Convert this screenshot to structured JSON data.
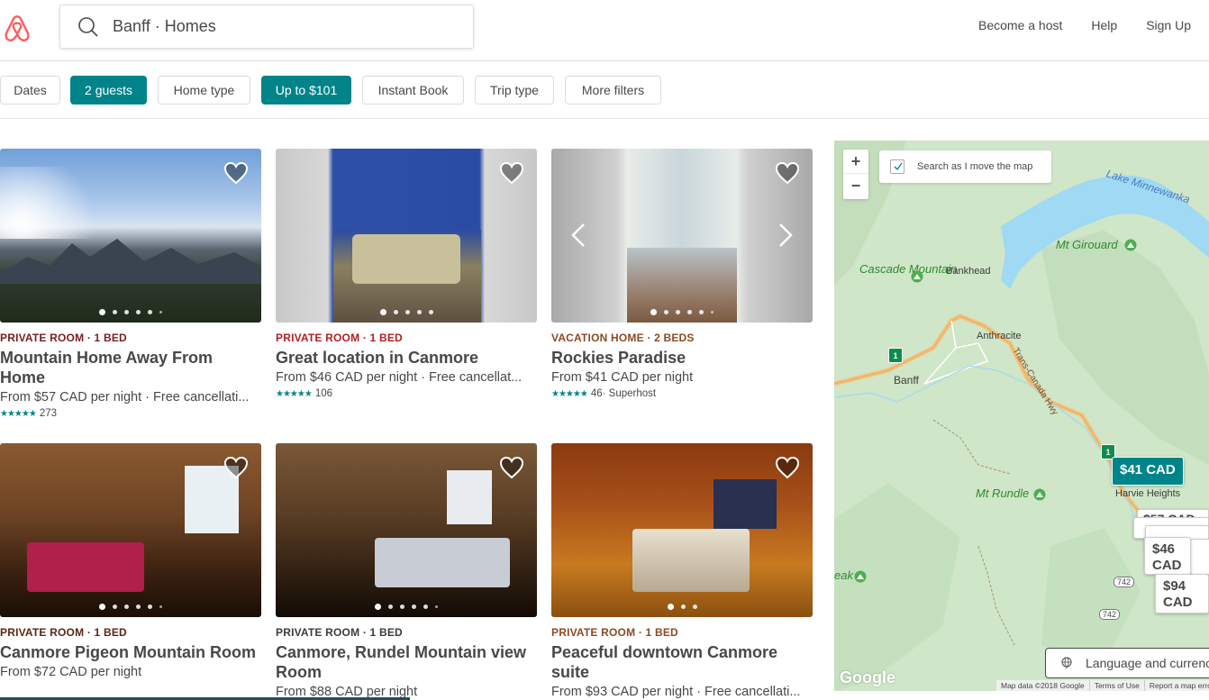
{
  "header": {
    "logo": "airbnb-logo",
    "search_value": "Banff · Homes",
    "nav": [
      "Become a host",
      "Help",
      "Sign Up"
    ]
  },
  "filters": [
    {
      "label": "Dates",
      "active": false
    },
    {
      "label": "2 guests",
      "active": true
    },
    {
      "label": "Home type",
      "active": false
    },
    {
      "label": "Up to $101",
      "active": true
    },
    {
      "label": "Instant Book",
      "active": false
    },
    {
      "label": "Trip type",
      "active": false
    },
    {
      "label": "More filters",
      "active": false
    }
  ],
  "colors": {
    "accent": "#008489",
    "brand": "#FF5A5F",
    "type_private_room_1": "#7B1D1D",
    "type_private_room_2": "#B21F1F",
    "type_vacation_home": "#8B4A22",
    "type_private_room_4": "#5C2614",
    "type_private_room_5": "#3B3B3B",
    "type_private_room_6": "#8B4A22"
  },
  "listings": [
    {
      "type": "PRIVATE ROOM · 1 BED",
      "title": "Mountain Home Away From Home",
      "price": "From $57 CAD  per night · Free cancellati...",
      "stars": "★★★★★",
      "reviews": "273",
      "extra": "",
      "photo_count": 6,
      "active_photo": 1
    },
    {
      "type": "PRIVATE ROOM · 1 BED",
      "title": "Great location in Canmore",
      "price": "From $46 CAD  per night · Free cancellat...",
      "stars": "★★★★★",
      "reviews": "106",
      "extra": "",
      "photo_count": 5,
      "active_photo": 1
    },
    {
      "type": "VACATION HOME · 2 BEDS",
      "title": "Rockies Paradise",
      "price": "From $41 CAD  per night",
      "stars": "★★★★★",
      "reviews": "46",
      "extra": " · Superhost",
      "photo_count": 6,
      "active_photo": 1
    },
    {
      "type": "PRIVATE ROOM · 1 BED",
      "title": "Canmore Pigeon Mountain Room",
      "price": "From $72 CAD  per night",
      "stars": "",
      "reviews": "",
      "extra": "",
      "photo_count": 6,
      "active_photo": 1
    },
    {
      "type": "PRIVATE ROOM · 1 BED",
      "title": "Canmore, Rundel Mountain view Room",
      "price": "From $88 CAD  per night",
      "stars": "",
      "reviews": "",
      "extra": "",
      "photo_count": 6,
      "active_photo": 1
    },
    {
      "type": "PRIVATE ROOM · 1 BED",
      "title": "Peaceful downtown Canmore suite",
      "price": "From $93 CAD  per night · Free cancellati...",
      "stars": "",
      "reviews": "",
      "extra": "",
      "photo_count": 3,
      "active_photo": 1
    }
  ],
  "map": {
    "search_as_move_label": "Search as I move the map",
    "search_as_move_checked": true,
    "zoom_in": "+",
    "zoom_out": "−",
    "labels": {
      "lake": "Lake Minnewanka",
      "mt_girouard": "Mt Girouard",
      "cascade": "Cascade Mountain",
      "bankhead": "Bankhead",
      "anthracite": "Anthracite",
      "highway": "Trans-Canada Hwy",
      "banff": "Banff",
      "mt_rundle": "Mt Rundle",
      "harvie": "Harvie Heights",
      "peak": "eak",
      "route1": "1",
      "route742a": "742",
      "route742b": "742"
    },
    "pins": {
      "selected": "$41 CAD",
      "p46": "$46 CAD",
      "p94": "$94 CAD",
      "p57": "$57 CAD"
    },
    "language_button": "Language and currency",
    "attribution": [
      "Map data ©2018 Google",
      "Terms of Use",
      "Report a map error"
    ],
    "google_logo": "Google"
  }
}
